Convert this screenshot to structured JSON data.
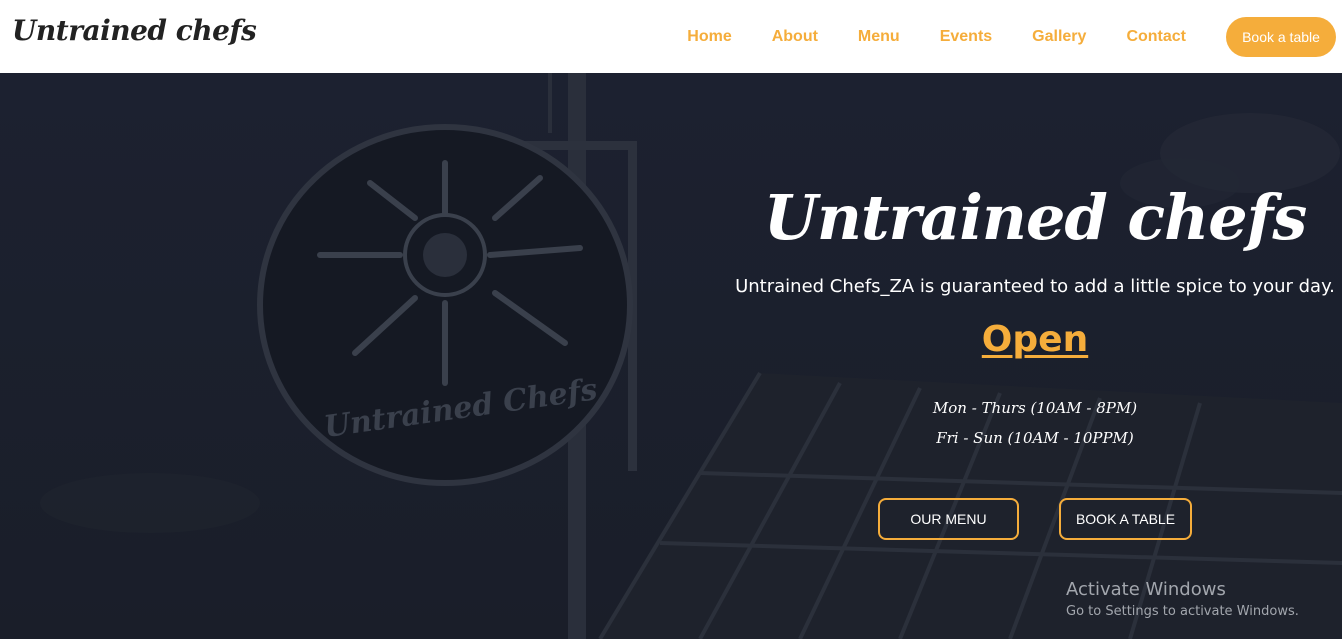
{
  "header": {
    "logo": "Untrained chefs",
    "nav": [
      {
        "label": "Home"
      },
      {
        "label": "About"
      },
      {
        "label": "Menu"
      },
      {
        "label": "Events"
      },
      {
        "label": "Gallery"
      },
      {
        "label": "Contact"
      }
    ],
    "book_button": "Book a table"
  },
  "hero": {
    "title": "Untrained chefs",
    "subtitle": "Untrained Chefs_ZA is guaranteed to add a little spice to your day.",
    "status": "Open",
    "hours": [
      "Mon - Thurs (10AM - 8PM)",
      "Fri - Sun (10AM - 10PPM)"
    ],
    "menu_button": "OUR MENU",
    "book_button": "BOOK A TABLE",
    "sign_text": "Untrained Chefs"
  },
  "watermark": {
    "title": "Activate Windows",
    "subtitle": "Go to Settings to activate Windows."
  },
  "colors": {
    "accent": "#f5ad3b",
    "header_bg": "#ffffff",
    "hero_overlay": "#1b1f2b"
  }
}
